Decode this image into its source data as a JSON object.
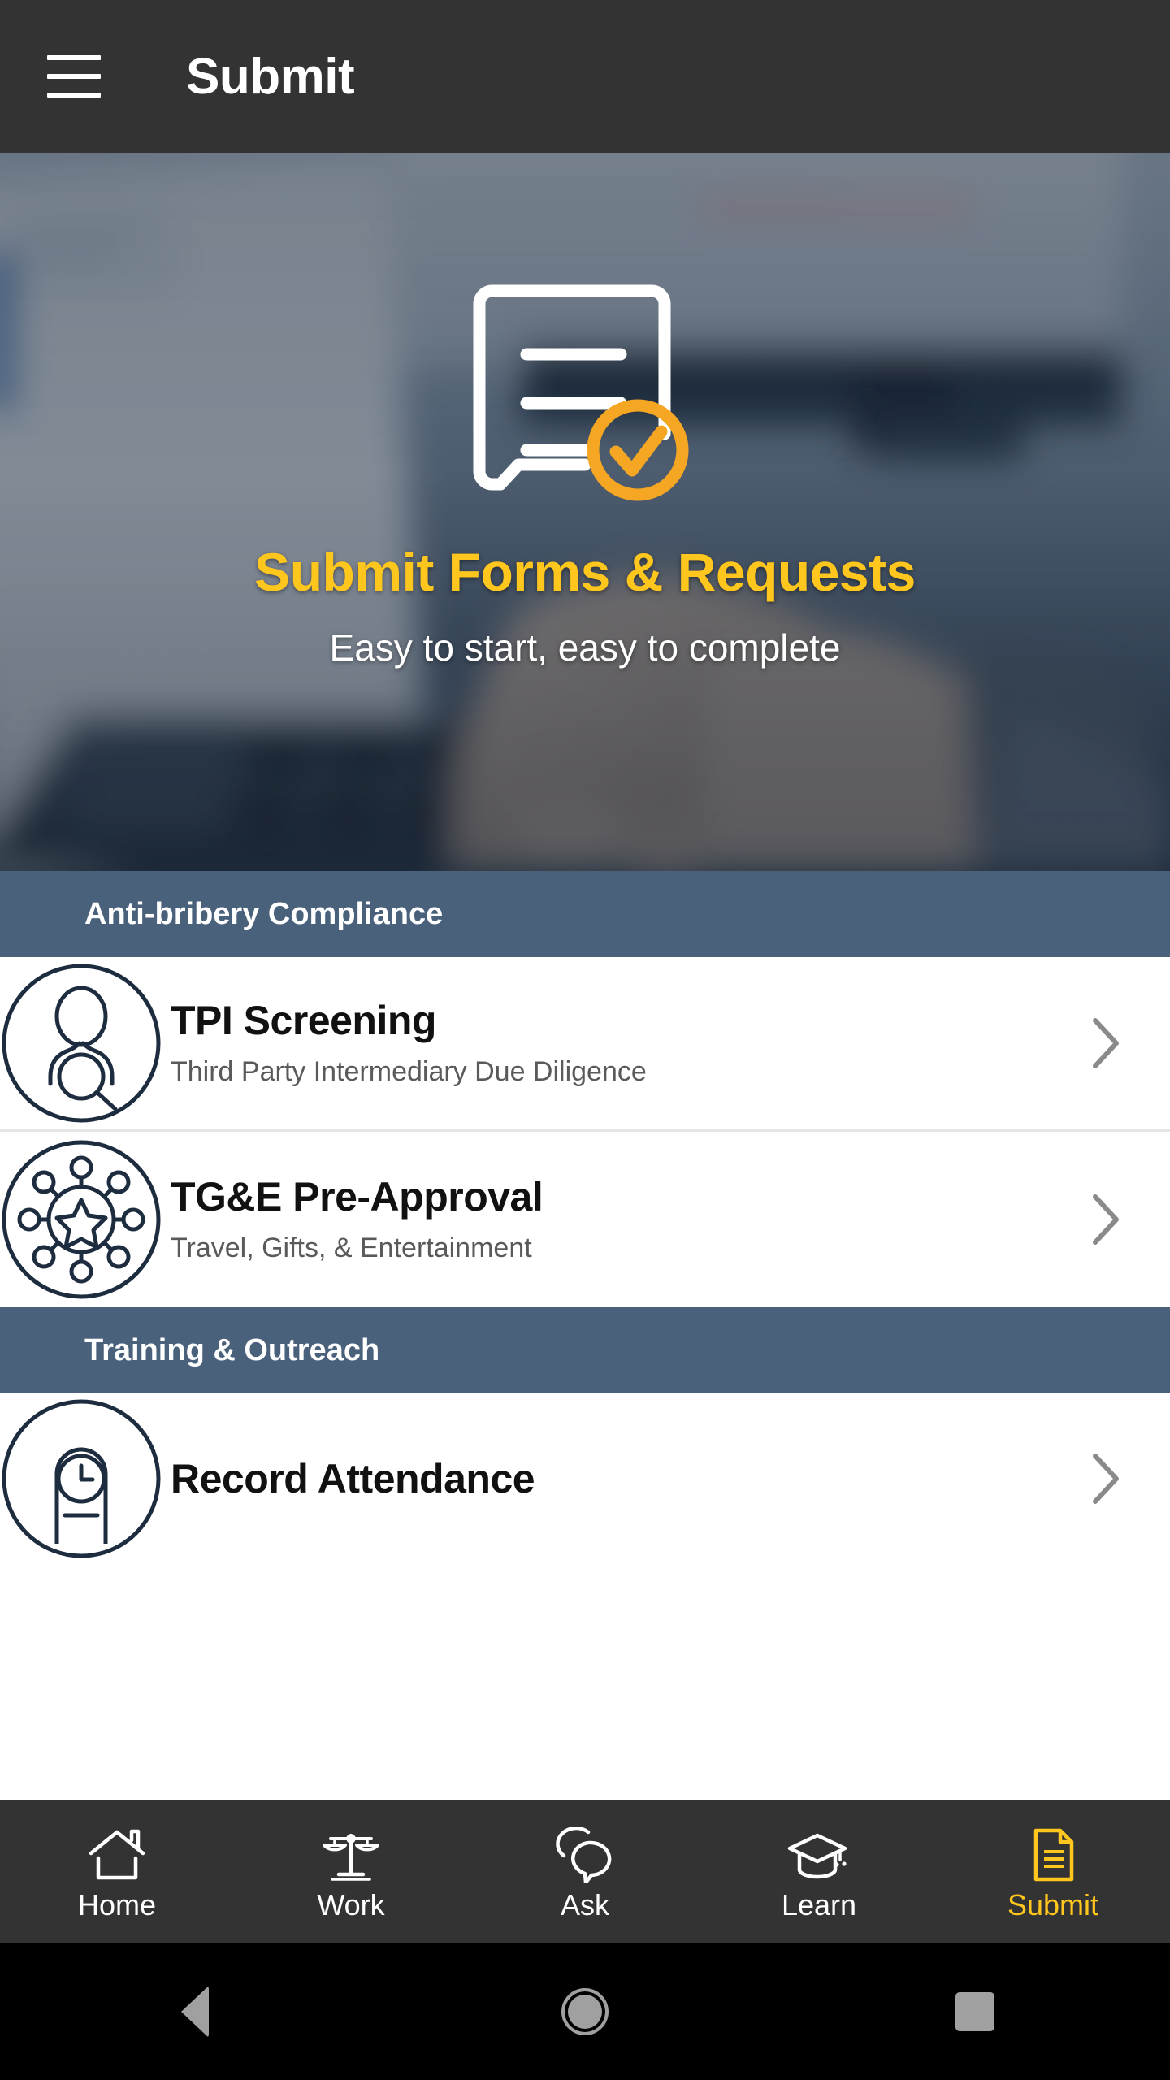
{
  "appbar": {
    "menu_icon": "hamburger-menu-icon",
    "title": "Submit"
  },
  "hero": {
    "icon": "document-check-icon",
    "title": "Submit Forms & Requests",
    "subtitle": "Easy to start, easy to complete",
    "title_color": "#ffc61e",
    "overlay_color": "#1a283a",
    "background": "blurred-photo-hands-typing-on-laptop"
  },
  "sections": [
    {
      "header": "Anti-bribery Compliance",
      "items": [
        {
          "icon": "person-search-icon",
          "title": "TPI Screening",
          "subtitle": "Third Party Intermediary Due Diligence",
          "chevron": "chevron-right-icon"
        },
        {
          "icon": "star-network-icon",
          "title": "TG&E Pre-Approval",
          "subtitle": "Travel, Gifts, & Entertainment",
          "chevron": "chevron-right-icon"
        }
      ]
    },
    {
      "header": "Training & Outreach",
      "items": [
        {
          "icon": "clock-badge-icon",
          "title": "Record Attendance",
          "subtitle": "",
          "chevron": "chevron-right-icon"
        }
      ]
    }
  ],
  "bottom_nav": {
    "active": "Submit",
    "active_color": "#ffc61e",
    "items": [
      {
        "label": "Home",
        "icon": "house-icon"
      },
      {
        "label": "Work",
        "icon": "scales-of-justice-icon"
      },
      {
        "label": "Ask",
        "icon": "speech-bubbles-icon"
      },
      {
        "label": "Learn",
        "icon": "graduation-cap-icon"
      },
      {
        "label": "Submit",
        "icon": "document-lines-icon"
      }
    ]
  },
  "system_bar": {
    "back": "back-triangle-icon",
    "home": "home-circle-icon",
    "recents": "recents-square-icon"
  },
  "colors": {
    "appbar_bg": "#333333",
    "section_header_bg": "#4a617c",
    "accent_yellow": "#ffc61e",
    "icon_navy": "#1d2d3f",
    "list_bg": "#ffffff",
    "divider": "#e6e6e6"
  }
}
